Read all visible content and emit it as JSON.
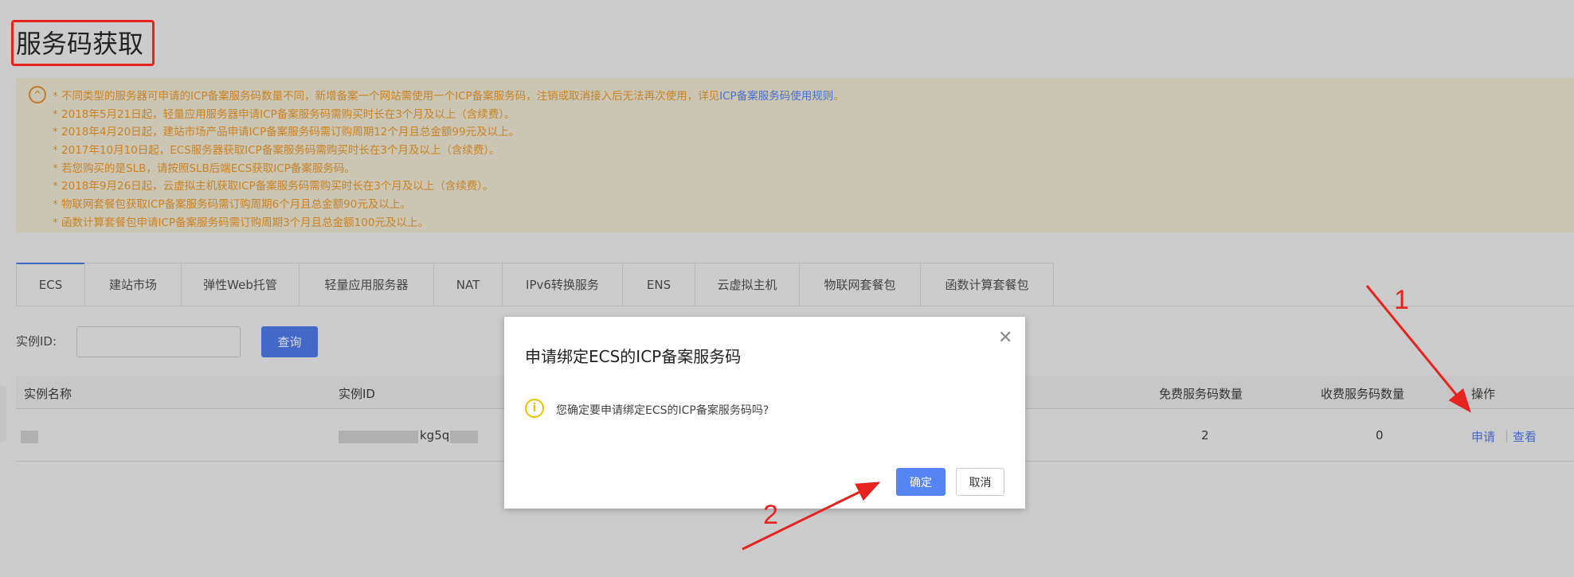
{
  "page": {
    "title": "服务码获取"
  },
  "notice": {
    "lines": [
      "* 不同类型的服务器可申请的ICP备案服务码数量不同，新增备案一个网站需使用一个ICP备案服务码，注销或取消接入后无法再次使用，详见",
      "* 2018年5月21日起，轻量应用服务器申请ICP备案服务码需购买时长在3个月及以上（含续费）。",
      "* 2018年4月20日起，建站市场产品申请ICP备案服务码需订购周期12个月且总金额99元及以上。",
      "* 2017年10月10日起，ECS服务器获取ICP备案服务码需购买时长在3个月及以上（含续费）。",
      "* 若您购买的是SLB，请按照SLB后端ECS获取ICP备案服务码。",
      "* 2018年9月26日起，云虚拟主机获取ICP备案服务码需购买时长在3个月及以上（含续费）。",
      "* 物联网套餐包获取ICP备案服务码需订购周期6个月且总金额90元及以上。",
      "* 函数计算套餐包申请ICP备案服务码需订购周期3个月且总金额100元及以上。"
    ],
    "link": "ICP备案服务码使用规则",
    "link_suffix": "。"
  },
  "tabs": [
    "ECS",
    "建站市场",
    "弹性Web托管",
    "轻量应用服务器",
    "NAT",
    "IPv6转换服务",
    "ENS",
    "云虚拟主机",
    "物联网套餐包",
    "函数计算套餐包"
  ],
  "search": {
    "label": "实例ID:",
    "value": "",
    "button": "查询"
  },
  "table": {
    "headers": [
      "实例名称",
      "实例ID",
      "免费服务码数量",
      "收费服务码数量",
      "操作"
    ],
    "rows": [
      {
        "id_partial": "kg5q",
        "free": "2",
        "paid": "0",
        "apply": "申请",
        "view": "查看"
      }
    ]
  },
  "dialog": {
    "title": "申请绑定ECS的ICP备案服务码",
    "message": "您确定要申请绑定ECS的ICP备案服务码吗?",
    "ok": "确定",
    "cancel": "取消",
    "close": "✕"
  },
  "annotations": {
    "step1": "1",
    "step2": "2"
  }
}
